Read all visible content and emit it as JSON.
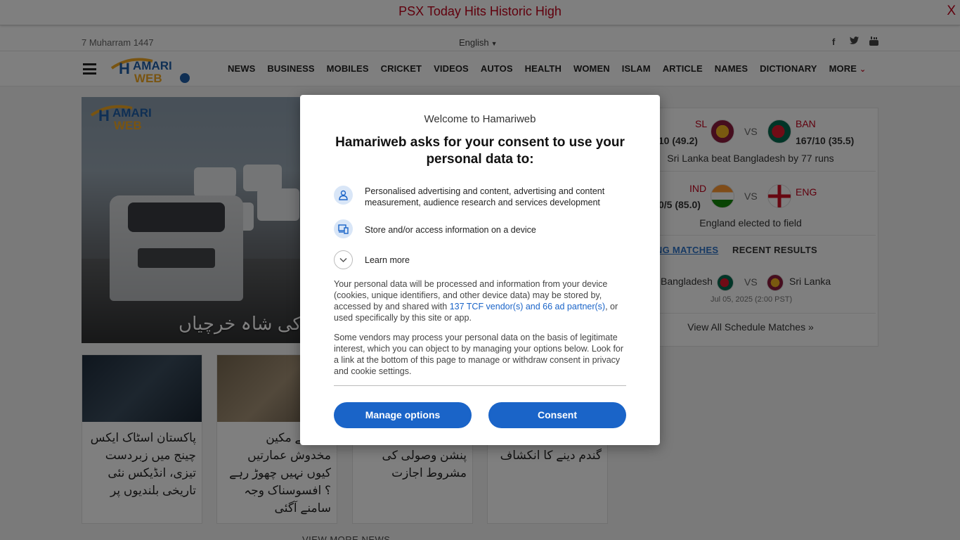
{
  "breaking": {
    "text": "PSX Today Hits Historic High",
    "close": "X"
  },
  "topbar": {
    "date": "7 Muharram 1447",
    "language": "English",
    "social": [
      "facebook-icon",
      "twitter-icon",
      "youtube-icon"
    ]
  },
  "nav": {
    "logo": "HAMARI WEB",
    "items": [
      "NEWS",
      "BUSINESS",
      "MOBILES",
      "CRICKET",
      "VIDEOS",
      "AUTOS",
      "HEALTH",
      "WOMEN",
      "ISLAM",
      "ARTICLE",
      "NAMES",
      "DICTIONARY",
      "MORE"
    ]
  },
  "hero": {
    "headline": "، اربوں روپے کی شاہ خرچیاں"
  },
  "cards": [
    {
      "title": "پاکستان اسٹاک ایکس چینج میں زبردست تیزی، انڈیکس نئی تاریخی بلندیوں پر"
    },
    {
      "title": "ایریا کے مکین مخدوش عمارتیں کیوں نہیں چھوڑ رہے ؟ افسوسناک وجہ سامنے آگئی"
    },
    {
      "title": "پر پنشنرز کو پچھلی پنشن وصولی کی مشروط اجازت"
    },
    {
      "title": "6 کروڑ سے زائد کی گندم دینے کا انکشاف"
    }
  ],
  "view_more": "VIEW MORE NEWS",
  "cricket": {
    "match1": {
      "team_a": "SL",
      "score_a": "/10 (49.2)",
      "team_b": "BAN",
      "score_b": "167/10 (35.5)",
      "vs": "VS",
      "result": "Sri Lanka beat Bangladesh by 77 runs"
    },
    "match2": {
      "team_a": "IND",
      "score_a": "0/5 (85.0)",
      "team_b": "ENG",
      "vs": "VS",
      "result": "England elected to field"
    },
    "tabs": [
      "ING MATCHES",
      "RECENT RESULTS"
    ],
    "upcoming": {
      "team_a": "Bangladesh",
      "team_b": "Sri Lanka",
      "vs": "VS",
      "date": "Jul 05, 2025 (2:00 PST)"
    },
    "view_all": "View All Schedule Matches »"
  },
  "dialog": {
    "welcome": "Welcome to Hamariweb",
    "heading": "Hamariweb asks for your consent to use your personal data to:",
    "purposes": [
      "Personalised advertising and content, advertising and content measurement, audience research and services development",
      "Store and/or access information on a device"
    ],
    "learn_more": "Learn more",
    "para1_a": "Your personal data will be processed and information from your device (cookies, unique identifiers, and other device data) may be stored by, accessed by and shared with ",
    "para1_link": "137 TCF vendor(s) and 66 ad partner(s)",
    "para1_b": ", or used specifically by this site or app.",
    "para2": "Some vendors may process your personal data on the basis of legitimate interest, which you can object to by managing your options below. Look for a link at the bottom of this page to manage or withdraw consent in privacy and cookie settings.",
    "manage_button": "Manage options",
    "consent_button": "Consent"
  },
  "colors": {
    "accent": "#c0001a",
    "button": "#1a64c8",
    "link": "#2e74c9"
  }
}
